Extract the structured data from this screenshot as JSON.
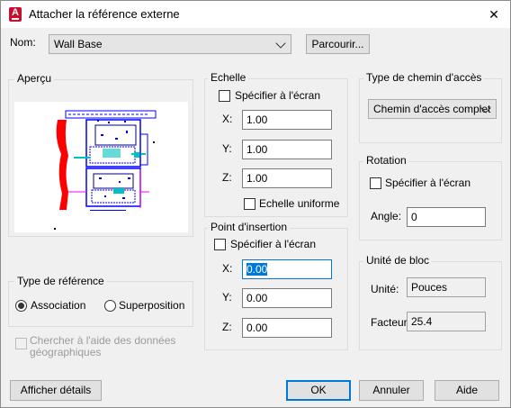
{
  "window": {
    "title": "Attacher la référence externe",
    "close_glyph": "✕",
    "app_icon_letter": "A"
  },
  "name_row": {
    "label": "Nom:",
    "value": "Wall Base",
    "browse_label": "Parcourir..."
  },
  "preview": {
    "title": "Aperçu"
  },
  "scale": {
    "title": "Echelle",
    "specify_on_screen": "Spécifier à l'écran",
    "x_label": "X:",
    "x_value": "1.00",
    "y_label": "Y:",
    "y_value": "1.00",
    "z_label": "Z:",
    "z_value": "1.00",
    "uniform_label": "Echelle uniforme"
  },
  "insertion": {
    "title": "Point d'insertion",
    "specify_on_screen": "Spécifier à l'écran",
    "x_label": "X:",
    "x_value": "0.00",
    "y_label": "Y:",
    "y_value": "0.00",
    "z_label": "Z:",
    "z_value": "0.00"
  },
  "path_type": {
    "title": "Type de chemin d'accès",
    "value": "Chemin d'accès complet"
  },
  "rotation": {
    "title": "Rotation",
    "specify_on_screen": "Spécifier à l'écran",
    "angle_label": "Angle:",
    "angle_value": "0"
  },
  "block_unit": {
    "title": "Unité de bloc",
    "unit_label": "Unité:",
    "unit_value": "Pouces",
    "factor_label": "Facteur:",
    "factor_value": "25.4"
  },
  "reference_type": {
    "title": "Type de référence",
    "attachment": "Association",
    "overlay": "Superposition",
    "selected": "Association"
  },
  "geo_check": {
    "line1": "Chercher à l'aide des données",
    "line2": "géographiques"
  },
  "buttons": {
    "details": "Afficher détails",
    "ok": "OK",
    "cancel": "Annuler",
    "help": "Aide"
  },
  "colors": {
    "accent": "#0078d7",
    "app_icon": "#c8102e",
    "preview_red": "#ff0000",
    "preview_blue": "#0000ff",
    "preview_cyan": "#00c0c0",
    "preview_magenta": "#ff00ff"
  }
}
